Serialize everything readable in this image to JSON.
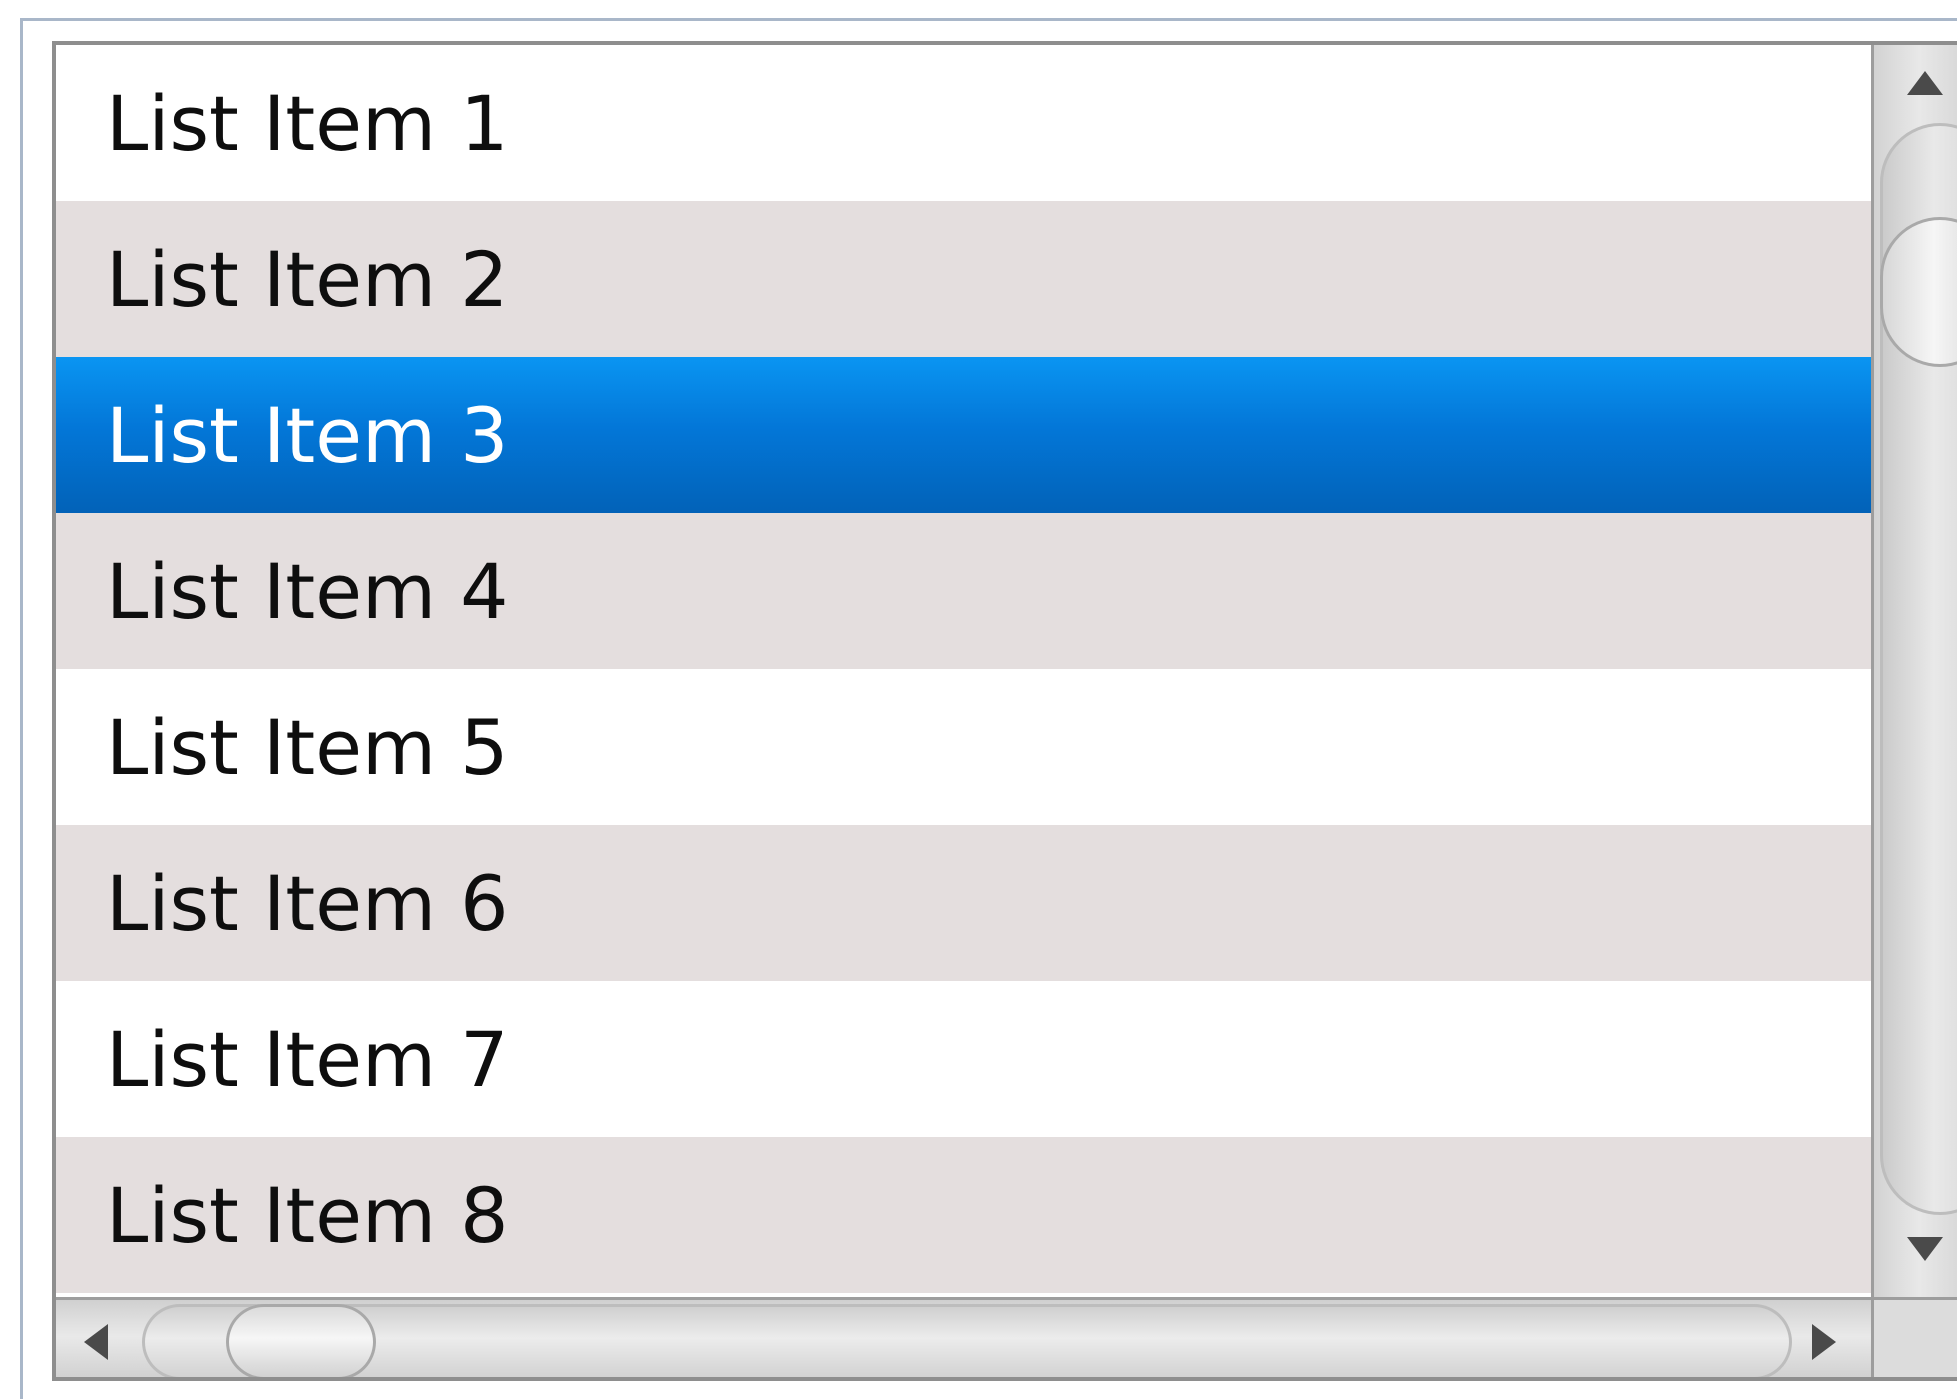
{
  "listbox": {
    "items": [
      {
        "label": "List Item 1",
        "selected": false
      },
      {
        "label": "List Item 2",
        "selected": false
      },
      {
        "label": "List Item 3",
        "selected": true
      },
      {
        "label": "List Item 4",
        "selected": false
      },
      {
        "label": "List Item 5",
        "selected": false
      },
      {
        "label": "List Item 6",
        "selected": false
      },
      {
        "label": "List Item 7",
        "selected": false
      },
      {
        "label": "List Item 8",
        "selected": false
      }
    ],
    "selected_color": "#0377d8",
    "alt_row_color": "#e4dede"
  },
  "vertical_scrollbar": {
    "up_icon": "arrow-up-icon",
    "down_icon": "arrow-down-icon",
    "position": 0.08
  },
  "horizontal_scrollbar": {
    "left_icon": "arrow-left-icon",
    "right_icon": "arrow-right-icon",
    "position": 0.05
  }
}
